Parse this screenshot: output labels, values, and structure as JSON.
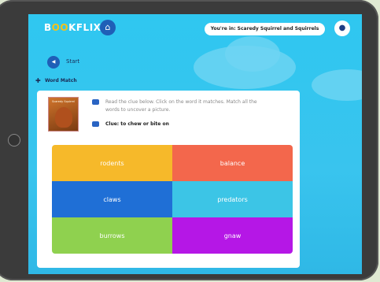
{
  "app": {
    "logo": {
      "pre": "B",
      "oo": "OO",
      "post": "KFLIX"
    },
    "location": "You're in: Scaredy Squirrel and Squirrels"
  },
  "nav": {
    "start_label": "Start",
    "start_icon": "back-arrow-icon"
  },
  "game": {
    "title": "Word Match"
  },
  "book": {
    "title": "Scaredy Squirrel"
  },
  "instructions": "Read the clue below. Click on the word it matches. Match all the words to uncover a picture.",
  "clue": "Clue: to chew or bite on",
  "tiles": [
    {
      "label": "rodents",
      "color": "#f6b92a"
    },
    {
      "label": "balance",
      "color": "#f3674c"
    },
    {
      "label": "claws",
      "color": "#1f6fd6"
    },
    {
      "label": "predators",
      "color": "#3cc5e6"
    },
    {
      "label": "burrows",
      "color": "#8fd14f"
    },
    {
      "label": "gnaw",
      "color": "#b517e6"
    }
  ]
}
